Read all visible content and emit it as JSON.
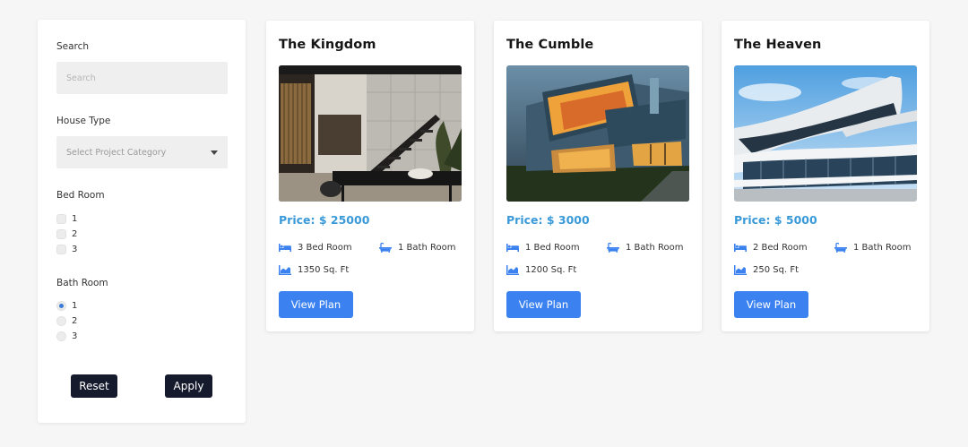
{
  "filters": {
    "search_label": "Search",
    "search_placeholder": "Search",
    "house_type_label": "House Type",
    "house_type_selected": "Select Project Category",
    "bed_room_label": "Bed Room",
    "bed_options": [
      "1",
      "2",
      "3"
    ],
    "bath_room_label": "Bath Room",
    "bath_options": [
      "1",
      "2",
      "3"
    ],
    "bath_selected": "1",
    "reset_label": "Reset",
    "apply_label": "Apply"
  },
  "properties": [
    {
      "title": "The Kingdom",
      "price": "Price: $ 25000",
      "beds": "3 Bed Room",
      "baths": "1 Bath Room",
      "area": "1350 Sq. Ft",
      "button": "View Plan"
    },
    {
      "title": "The Cumble",
      "price": "Price: $ 3000",
      "beds": "1 Bed Room",
      "baths": "1 Bath Room",
      "area": "1200 Sq. Ft",
      "button": "View Plan"
    },
    {
      "title": "The Heaven",
      "price": "Price: $ 5000",
      "beds": "2 Bed Room",
      "baths": "1 Bath Room",
      "area": "250 Sq. Ft",
      "button": "View Plan"
    }
  ],
  "colors": {
    "accent_blue": "#3b82f0",
    "price_blue": "#3a9ad9",
    "dark_button": "#151a2d",
    "page_bg": "#f6f6f6"
  },
  "icons": {
    "bed": "bed-icon",
    "bath": "bathtub-icon",
    "area": "area-chart-icon",
    "select": "chevron-down-icon"
  }
}
